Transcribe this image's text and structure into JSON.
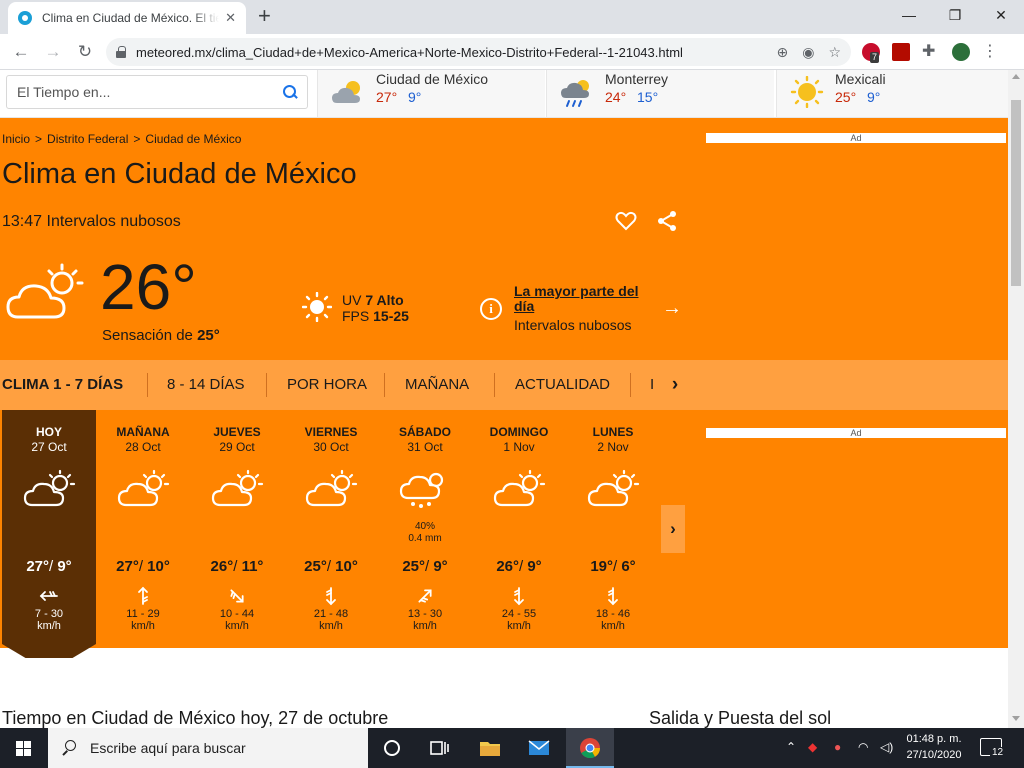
{
  "browser": {
    "tab_title": "Clima en Ciudad de México. El tiempo",
    "url": "meteored.mx/clima_Ciudad+de+Mexico-America+Norte-Mexico-Distrito+Federal--1-21043.html",
    "abp_badge": "7"
  },
  "site": {
    "search_placeholder": "El Tiempo en...",
    "cities": [
      {
        "name": "Ciudad de México",
        "max": "27°",
        "min": "9°",
        "icon": "partly-cloudy-icon"
      },
      {
        "name": "Monterrey",
        "max": "24°",
        "min": "15°",
        "icon": "rain-cloud-icon"
      },
      {
        "name": "Mexicali",
        "max": "25°",
        "min": "9°",
        "icon": "sun-icon"
      }
    ]
  },
  "header": {
    "breadcrumb": [
      "Inicio",
      "Distrito Federal",
      "Ciudad de México"
    ],
    "breadcrumb_sep": ">",
    "title": "Clima en Ciudad de México",
    "time": "13:47",
    "condition": "Intervalos nubosos",
    "temp": "26°",
    "feels_label": "Sensación de",
    "feels_value": "25°",
    "uv_label": "UV",
    "uv_value": "7 Alto",
    "fps_label": "FPS",
    "fps_value": "15-25",
    "most_day_title": "La mayor parte del día",
    "most_day_desc": "Intervalos nubosos"
  },
  "ads": {
    "label": "Ad"
  },
  "tabs": [
    "CLIMA 1 - 7 DÍAS",
    "8 - 14 DÍAS",
    "POR HORA",
    "MAÑANA",
    "ACTUALIDAD",
    "I"
  ],
  "forecast": [
    {
      "day": "HOY",
      "date": "27 Oct",
      "max": "27°",
      "min": "9°",
      "wind": "7 - 30",
      "unit": "km/h",
      "icon": "partly-cloudy-icon",
      "wind_dir": 270,
      "rain": false
    },
    {
      "day": "MAÑANA",
      "date": "28 Oct",
      "max": "27°",
      "min": "10°",
      "wind": "11 - 29",
      "unit": "km/h",
      "icon": "partly-cloudy-icon",
      "wind_dir": 0,
      "rain": false
    },
    {
      "day": "JUEVES",
      "date": "29 Oct",
      "max": "26°",
      "min": "11°",
      "wind": "10 - 44",
      "unit": "km/h",
      "icon": "partly-cloudy-icon",
      "wind_dir": 135,
      "rain": false
    },
    {
      "day": "VIERNES",
      "date": "30 Oct",
      "max": "25°",
      "min": "10°",
      "wind": "21 - 48",
      "unit": "km/h",
      "icon": "partly-cloudy-icon",
      "wind_dir": 180,
      "rain": false
    },
    {
      "day": "SÁBADO",
      "date": "31 Oct",
      "max": "25°",
      "min": "9°",
      "wind": "13 - 30",
      "unit": "km/h",
      "icon": "rain-cloud-icon",
      "wind_dir": 45,
      "rain": true,
      "prob": "40%",
      "mm": "0.4 mm"
    },
    {
      "day": "DOMINGO",
      "date": "1 Nov",
      "max": "26°",
      "min": "9°",
      "wind": "24 - 55",
      "unit": "km/h",
      "icon": "partly-cloudy-icon",
      "wind_dir": 180,
      "rain": false
    },
    {
      "day": "LUNES",
      "date": "2 Nov",
      "max": "19°",
      "min": "6°",
      "wind": "18 - 46",
      "unit": "km/h",
      "icon": "partly-cloudy-icon",
      "wind_dir": 180,
      "rain": false
    }
  ],
  "below": {
    "today_title": "Tiempo en Ciudad de México hoy, 27 de octubre",
    "sun_title": "Salida y Puesta del sol"
  },
  "taskbar": {
    "search_text": "Escribe aquí para buscar",
    "time": "01:48 p. m.",
    "date": "27/10/2020",
    "notif_count": "12"
  },
  "colors": {
    "brand_orange": "#ff8400",
    "tab_orange": "#ffa040",
    "today_brown": "#5b2f05",
    "max_red": "#c8290a",
    "min_blue": "#1d5fd1"
  }
}
